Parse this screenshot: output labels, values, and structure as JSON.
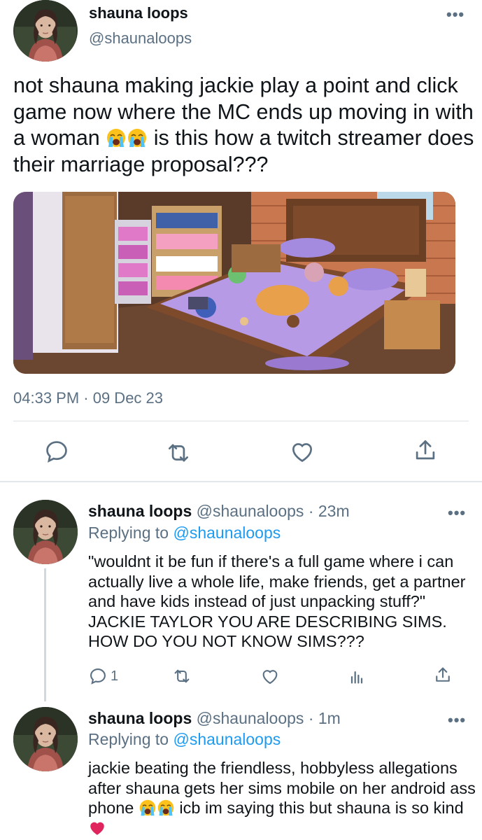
{
  "main_tweet": {
    "name": "shauna loops",
    "handle": "@shaunaloops",
    "text_part1": "not shauna making jackie play a point and click game now where the MC ends up moving in with a woman ",
    "text_part2": " is this how a twitch streamer does their marriage proposal???",
    "timestamp": "04:33 PM · 09 Dec 23",
    "media_description_icon": "cozy-bedroom-game-image"
  },
  "replies": [
    {
      "name": "shauna loops",
      "handle": "@shaunaloops",
      "time": "23m",
      "replying_label": "Replying to ",
      "replying_handle": "@shaunaloops",
      "text": "\"wouldnt it be fun if there's a full game where i can actually live a whole life, make friends, get a partner and have kids instead of just unpacking stuff?\" JACKIE TAYLOR YOU ARE DESCRIBING SIMS. HOW DO YOU NOT KNOW SIMS???",
      "reply_count": "1"
    },
    {
      "name": "shauna loops",
      "handle": "@shaunaloops",
      "time": "1m",
      "replying_label": "Replying to ",
      "replying_handle": "@shaunaloops",
      "text_part1": "jackie beating the friendless, hobbyless allegations after shauna gets her sims mobile on her android ass phone ",
      "text_part2": " icb im saying this but shauna is so kind "
    }
  ],
  "separators": {
    "name_dot": " · "
  },
  "colors": {
    "text": "#0f1419",
    "secondary": "#5b7083",
    "link": "#1d9bf0",
    "divider": "#dde2e6"
  },
  "icons": [
    "more-icon",
    "reply-icon",
    "retweet-icon",
    "like-icon",
    "share-icon",
    "analytics-icon",
    "loudly-crying-face-emoji",
    "red-heart-emoji"
  ]
}
